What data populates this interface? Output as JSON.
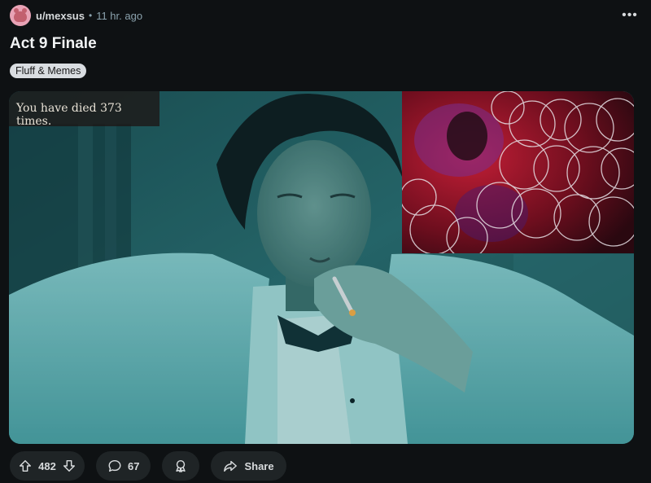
{
  "post": {
    "username": "u/mexsus",
    "separator": "•",
    "time": "11 hr. ago",
    "title": "Act 9 Finale",
    "flair": "Fluff & Memes"
  },
  "media": {
    "overlay_text": "You have died 373 times."
  },
  "actions": {
    "upvotes": "482",
    "comments": "67",
    "share_label": "Share"
  },
  "icons": {
    "more": "more-options-icon",
    "upvote": "upvote-arrow-icon",
    "downvote": "downvote-arrow-icon",
    "comment": "speech-bubble-icon",
    "award": "award-icon",
    "share": "share-arrow-icon"
  },
  "colors": {
    "background": "#0e1113",
    "pill": "#1f2426",
    "flair": "#d9dde1",
    "muted_text": "#8ba2ad"
  }
}
